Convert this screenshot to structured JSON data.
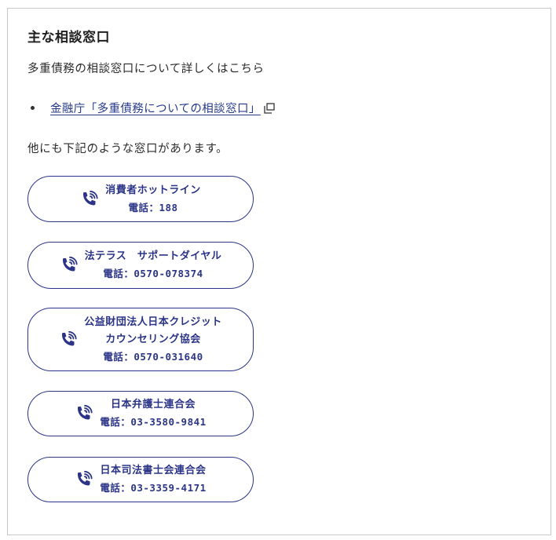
{
  "heading": "主な相談窓口",
  "intro": "多重債務の相談窓口について詳しくはこちら",
  "link": {
    "label": "金融庁「多重債務についての相談窓口」"
  },
  "other_text": "他にも下記のような窓口があります。",
  "contacts": [
    {
      "name": "消費者ホットライン",
      "tel": "電話：188"
    },
    {
      "name": "法テラス　サポートダイヤル",
      "tel": "電話：0570-078374"
    },
    {
      "name_line1": "公益財団法人日本クレジット",
      "name_line2": "カウンセリング協会",
      "tel": "電話：0570-031640"
    },
    {
      "name": "日本弁護士連合会",
      "tel": "電話：03-3580-9841"
    },
    {
      "name": "日本司法書士会連合会",
      "tel": "電話：03-3359-4171"
    }
  ],
  "colors": {
    "accent": "#2b3487",
    "link": "#263a8a",
    "border": "#c9c9c9"
  },
  "icons": {
    "phone": "phone-icon",
    "external": "external-link-icon"
  }
}
